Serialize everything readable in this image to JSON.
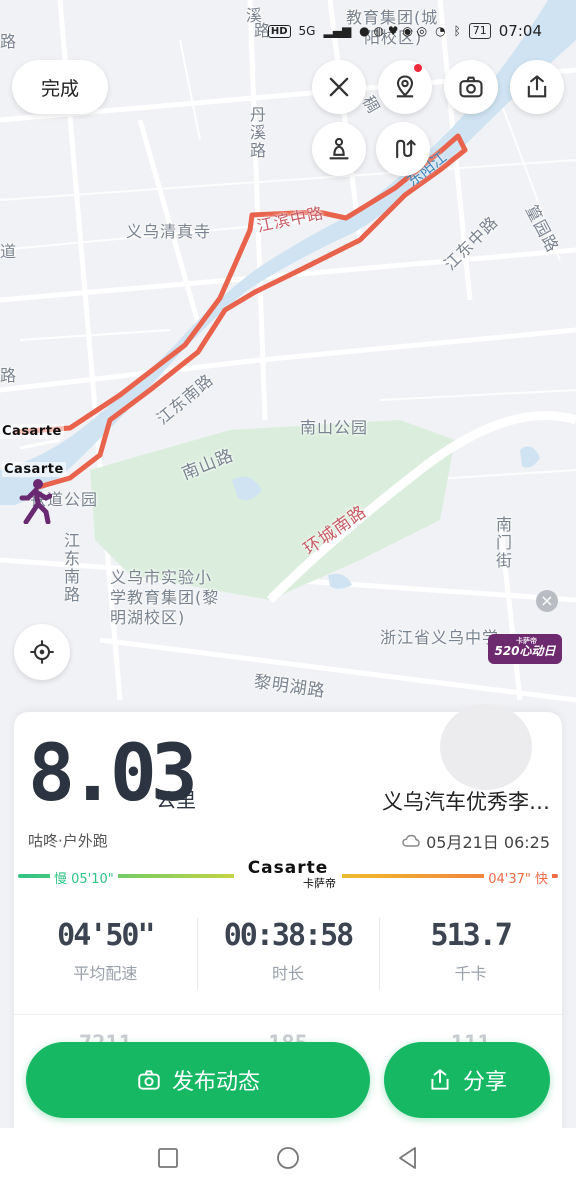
{
  "status_bar": {
    "time": "07:04",
    "battery": "71",
    "network": "5G",
    "hd": "HD"
  },
  "map": {
    "labels": {
      "top_left_road": "路",
      "xi_top": "溪",
      "edu_group": "教育集团(城",
      "edu_campus": "阳校区)",
      "danxi_road": "丹溪路",
      "qingzhen": "义乌清真寺",
      "jiangbin_road": "江滨中路",
      "jiangdong_road": "江东中路",
      "donghe_road": "篁园路",
      "left_dao": "道",
      "left_lu": "路",
      "jiangdong_south": "江东南路",
      "jiangdong_south_v": "江东南路",
      "nanshan_road": "南山路",
      "nanshan_park": "南山公园",
      "huancheng_road": "环城南路",
      "nanmen_street": "南门街",
      "shiyan_school": "义乌市实验小学教育集团(黎明湖校区)",
      "zhejiang_school": "浙江省义乌中学",
      "liminghu_road": "黎明湖路",
      "riverside_park": "铁道公园",
      "dongyang_river": "东阳江",
      "top_dingbu": "稠"
    },
    "brand_tags": [
      "Casarte",
      "Casarte"
    ],
    "ad": {
      "main": "520心动日",
      "small": "卡萨帝",
      "close": "×"
    },
    "icons": {
      "close": "close-icon",
      "location_pin": "location-pin-icon",
      "camera": "camera-icon",
      "share": "share-icon",
      "runner": "runner-icon",
      "route": "route-icon",
      "locate": "locate-icon"
    }
  },
  "controls": {
    "done_label": "完成"
  },
  "card": {
    "distance": "8.03",
    "distance_unit": "公里",
    "place": "义乌汽车优秀李…",
    "source": "咕咚·户外跑",
    "date": "05月21日 06:25",
    "pace_slow": "慢 05'10\"",
    "pace_fast": "04'37\" 快",
    "sponsor_en": "Casarte",
    "sponsor_cn": "卡萨帝",
    "stats": [
      {
        "value": "04'50\"",
        "label": "平均配速"
      },
      {
        "value": "00:38:58",
        "label": "时长"
      },
      {
        "value": "513.7",
        "label": "千卡"
      }
    ],
    "hidden_row": [
      "7211",
      "185",
      "111"
    ]
  },
  "actions": {
    "post_label": "发布动态",
    "share_label": "分享"
  },
  "colors": {
    "accent_green": "#16b864",
    "route_red": "#e8624c",
    "river_blue": "#cfe3f2",
    "park_green": "#dbeedd"
  }
}
